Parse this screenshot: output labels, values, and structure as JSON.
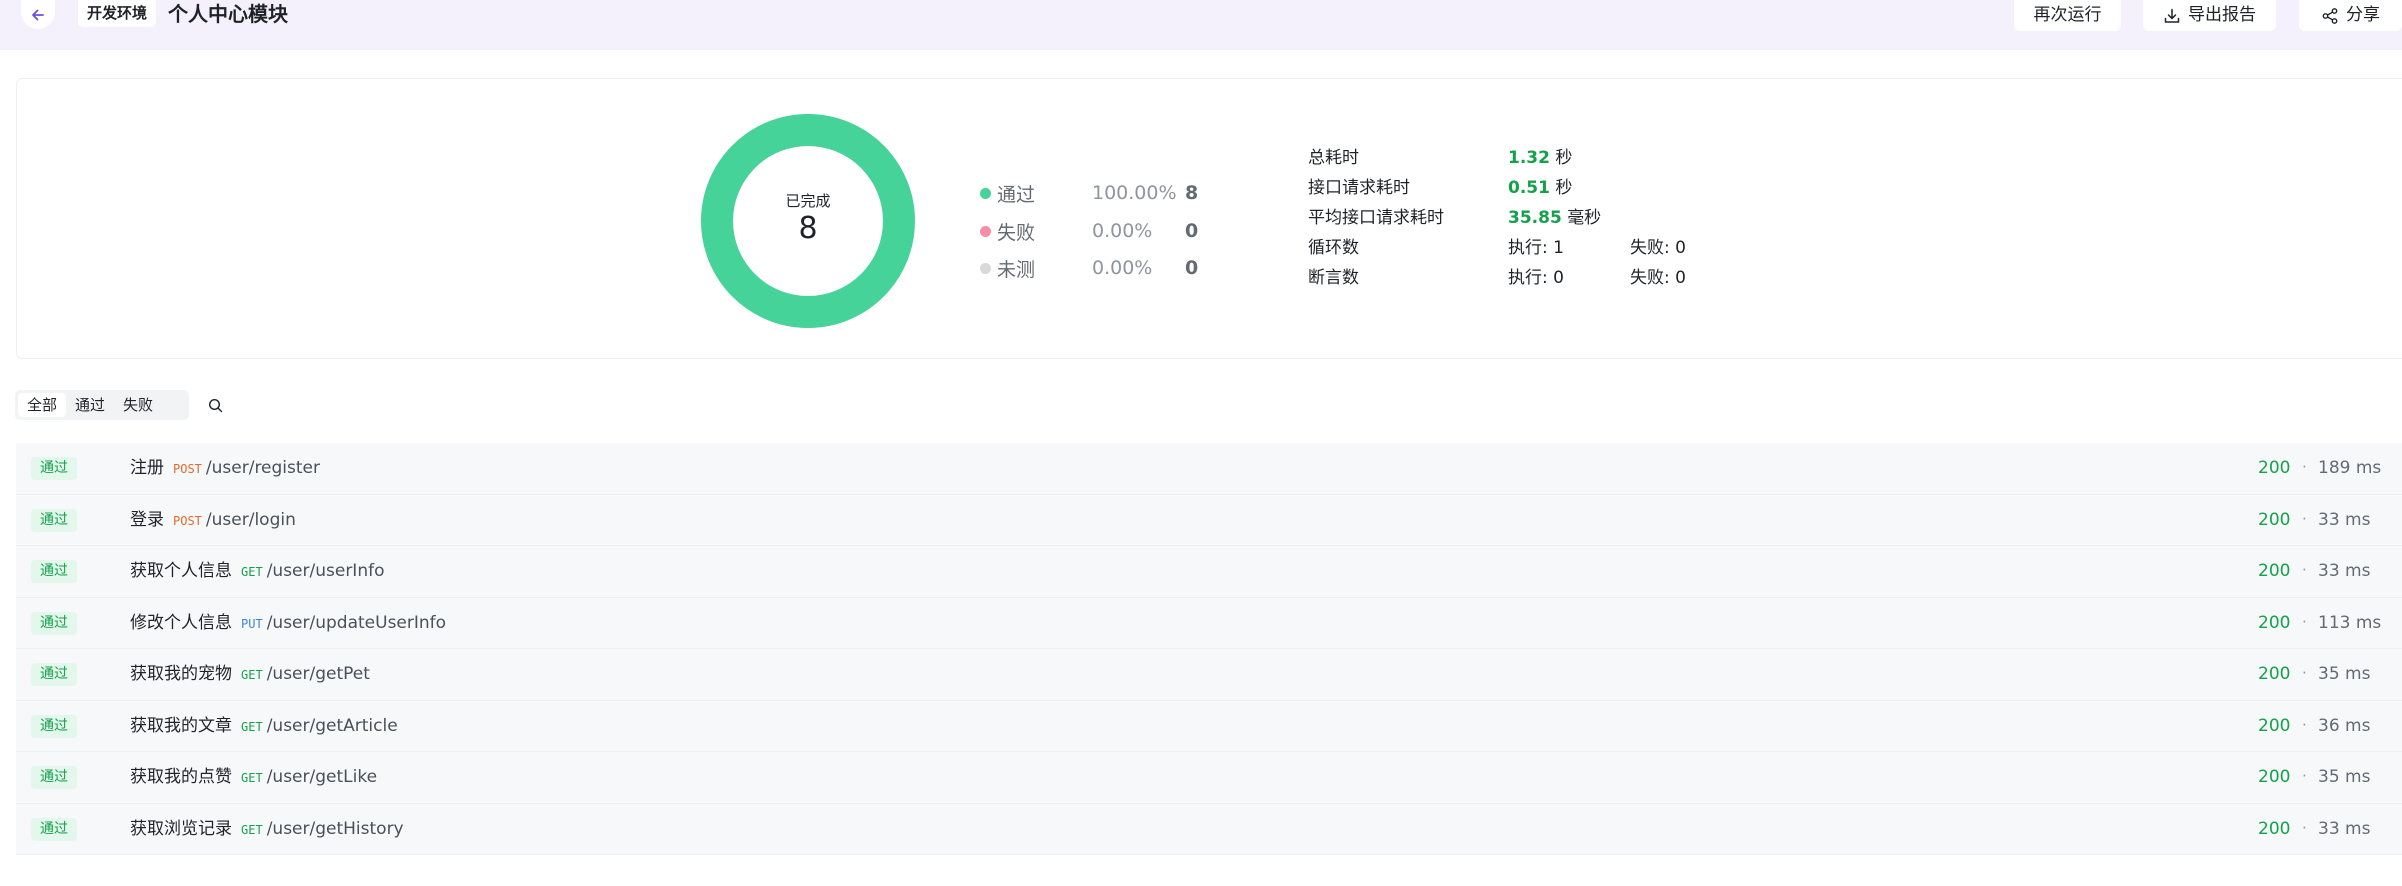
{
  "header": {
    "env_badge": "开发环境",
    "title": "个人中心模块",
    "rerun_label": "再次运行",
    "export_label": "导出报告",
    "share_label": "分享"
  },
  "summary": {
    "donut_label": "已完成",
    "donut_value": "8",
    "donut_pass_fraction": 1.0,
    "colors": {
      "pass": "#46d39a",
      "fail": "#f48fa5",
      "untested": "#d9d9d9"
    },
    "legend": [
      {
        "name": "通过",
        "percent": "100.00%",
        "count": "8"
      },
      {
        "name": "失败",
        "percent": "0.00%",
        "count": "0"
      },
      {
        "name": "未测",
        "percent": "0.00%",
        "count": "0"
      }
    ],
    "stats": {
      "total_time_label": "总耗时",
      "total_time_value": "1.32",
      "total_time_unit": "秒",
      "req_time_label": "接口请求耗时",
      "req_time_value": "0.51",
      "req_time_unit": "秒",
      "avg_time_label": "平均接口请求耗时",
      "avg_time_value": "35.85",
      "avg_time_unit": "毫秒",
      "loop_label": "循环数",
      "loop_exec": "执行: 1",
      "loop_fail": "失败: 0",
      "assert_label": "断言数",
      "assert_exec": "执行: 0",
      "assert_fail": "失败: 0"
    }
  },
  "filters": {
    "tabs": [
      "全部",
      "通过",
      "失败"
    ],
    "active": "全部"
  },
  "results": [
    {
      "status": "通过",
      "name": "注册",
      "method": "POST",
      "path": "/user/register",
      "code": "200",
      "time": "189 ms"
    },
    {
      "status": "通过",
      "name": "登录",
      "method": "POST",
      "path": "/user/login",
      "code": "200",
      "time": "33 ms"
    },
    {
      "status": "通过",
      "name": "获取个人信息",
      "method": "GET",
      "path": "/user/userInfo",
      "code": "200",
      "time": "33 ms"
    },
    {
      "status": "通过",
      "name": "修改个人信息",
      "method": "PUT",
      "path": "/user/updateUserInfo",
      "code": "200",
      "time": "113 ms"
    },
    {
      "status": "通过",
      "name": "获取我的宠物",
      "method": "GET",
      "path": "/user/getPet",
      "code": "200",
      "time": "35 ms"
    },
    {
      "status": "通过",
      "name": "获取我的文章",
      "method": "GET",
      "path": "/user/getArticle",
      "code": "200",
      "time": "36 ms"
    },
    {
      "status": "通过",
      "name": "获取我的点赞",
      "method": "GET",
      "path": "/user/getLike",
      "code": "200",
      "time": "35 ms"
    },
    {
      "status": "通过",
      "name": "获取浏览记录",
      "method": "GET",
      "path": "/user/getHistory",
      "code": "200",
      "time": "33 ms"
    }
  ],
  "separator": "·"
}
